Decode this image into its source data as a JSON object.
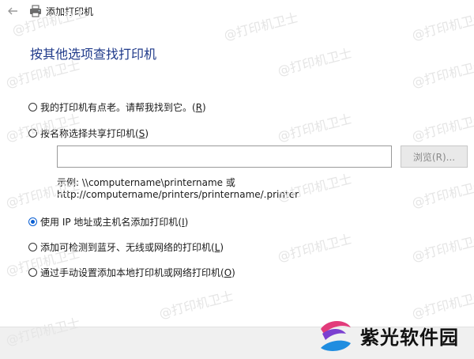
{
  "window": {
    "title": "添加打印机"
  },
  "main": {
    "heading": "按其他选项查找打印机",
    "options": [
      {
        "label": "我的打印机有点老。请帮我找到它。",
        "key": "R",
        "checked": false
      },
      {
        "label": "按名称选择共享打印机",
        "key": "S",
        "checked": false
      },
      {
        "label": "使用 IP 地址或主机名添加打印机",
        "key": "I",
        "checked": true
      },
      {
        "label": "添加可检测到蓝牙、无线或网络的打印机",
        "key": "L",
        "checked": false
      },
      {
        "label": "通过手动设置添加本地打印机或网络打印机",
        "key": "O",
        "checked": false
      }
    ],
    "share_path": {
      "value": ""
    },
    "browse_label": "浏览(R)...",
    "example_line1": "示例: \\\\computername\\printername 或",
    "example_line2": "http://computername/printers/printername/.printer"
  },
  "watermark_text": "@打印机卫士",
  "brand": {
    "name": "紫光软件园"
  },
  "colors": {
    "accent": "#0a5fd3",
    "heading": "#1f3a8a"
  }
}
